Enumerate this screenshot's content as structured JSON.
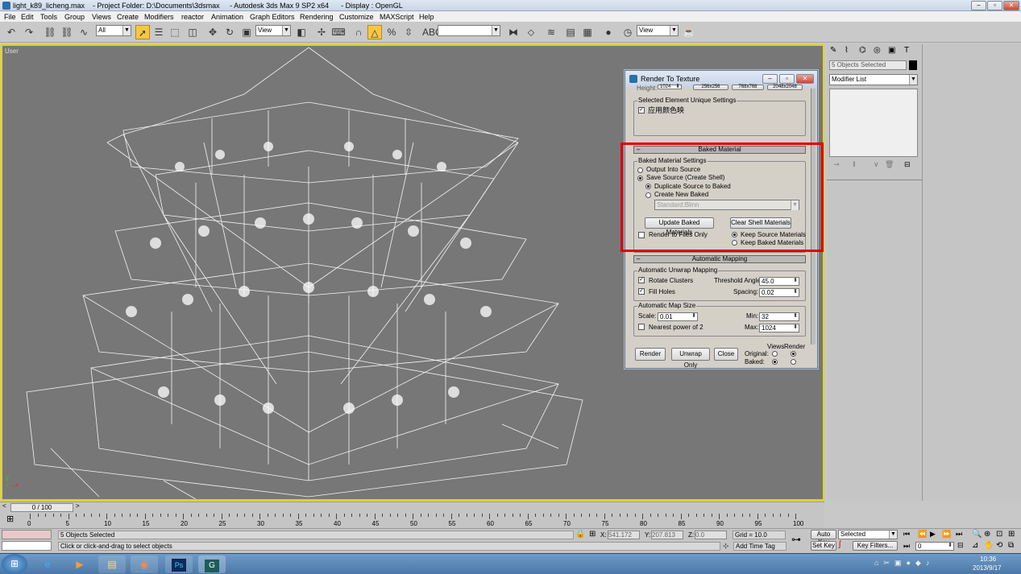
{
  "window": {
    "title": "light_k89_licheng.max    - Project Folder: D:\\Documents\\3dsmax     - Autodesk 3ds Max 9 SP2 x64      - Display : OpenGL"
  },
  "menu": [
    "File",
    "Edit",
    "Tools",
    "Group",
    "Views",
    "Create",
    "Modifiers",
    "reactor",
    "Animation",
    "Graph Editors",
    "Rendering",
    "Customize",
    "MAXScript",
    "Help"
  ],
  "toolbar": {
    "selection_filter": "All",
    "ref_coord": "View",
    "named_selection": "",
    "render_preset": "View"
  },
  "viewport": {
    "label": "User"
  },
  "command_panel": {
    "selection_name": "5 Objects Selected",
    "modifier_list": "Modifier List"
  },
  "dialog": {
    "title": "Render To Texture",
    "top_partial": [
      "Height:",
      "1024",
      "256x256",
      "768x768",
      "2048x2048"
    ],
    "unique_settings_label": "Selected Element Unique Settings",
    "unique_checkbox_label": "应用颜色映",
    "baked_rollout": "Baked Material",
    "baked_group": "Baked Material Settings",
    "output_into_source": "Output Into Source",
    "save_source": "Save Source (Create Shell)",
    "duplicate_source": "Duplicate Source to Baked",
    "create_new_baked": "Create New Baked",
    "material_type": "Standard:Blinn",
    "update_button": "Update Baked Materials",
    "clear_button": "Clear Shell Materials",
    "render_files_only": "Render to Files Only",
    "keep_source": "Keep Source Materials",
    "keep_baked": "Keep Baked Materials",
    "mapping_rollout": "Automatic Mapping",
    "unwrap_group": "Automatic Unwrap Mapping",
    "rotate_clusters": "Rotate Clusters",
    "threshold_label": "Threshold Angle:",
    "threshold_value": "45.0",
    "fill_holes": "Fill Holes",
    "spacing_label": "Spacing:",
    "spacing_value": "0.02",
    "map_size_group": "Automatic Map Size",
    "scale_label": "Scale:",
    "scale_value": "0.01",
    "min_label": "Min:",
    "min_value": "32",
    "nearest_power": "Nearest power of 2",
    "max_label": "Max:",
    "max_value": "1024",
    "render_button": "Render",
    "unwrap_only_button": "Unwrap Only",
    "close_button": "Close",
    "views_label": "Views",
    "render_label": "Render",
    "original_label": "Original:",
    "baked_label": "Baked:"
  },
  "timeline": {
    "frame": "0 / 100",
    "ticks": [
      "0",
      "5",
      "10",
      "15",
      "20",
      "25",
      "30",
      "35",
      "40",
      "45",
      "50",
      "55",
      "60",
      "65",
      "70",
      "75",
      "80",
      "85",
      "90",
      "95",
      "100"
    ]
  },
  "status": {
    "selected": "5 Objects Selected",
    "prompt": "Click or click-and-drag to select objects",
    "x_label": "X:",
    "x_value": "541.172",
    "y_label": "Y:",
    "y_value": "207.813",
    "z_label": "Z:",
    "z_value": "0.0",
    "grid": "Grid = 10.0",
    "add_time_tag": "Add Time Tag",
    "auto_key": "Auto Key",
    "set_key": "Set Key",
    "selected_dropdown": "Selected",
    "key_filters": "Key Filters...",
    "frame_value": "0"
  },
  "taskbar": {
    "time": "10:36",
    "date": "2013/9/17"
  },
  "colors": {
    "highlight": "#e00000",
    "viewport_border": "#e6d400",
    "viewport_bg": "#777777"
  }
}
